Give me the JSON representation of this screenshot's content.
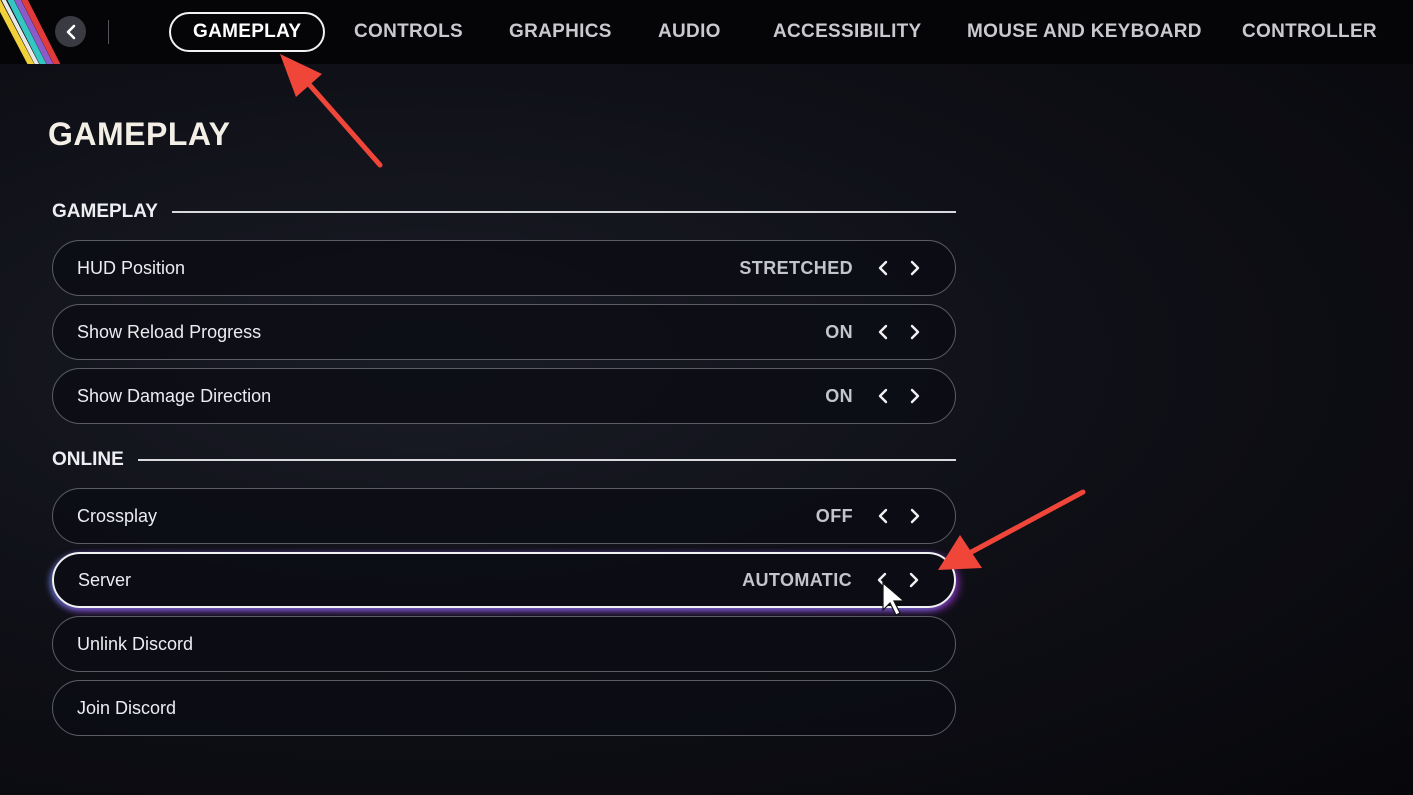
{
  "tabs": [
    {
      "label": "GAMEPLAY",
      "active": true
    },
    {
      "label": "CONTROLS"
    },
    {
      "label": "GRAPHICS"
    },
    {
      "label": "AUDIO"
    },
    {
      "label": "ACCESSIBILITY"
    },
    {
      "label": "MOUSE AND KEYBOARD"
    },
    {
      "label": "CONTROLLER"
    }
  ],
  "page_title": "GAMEPLAY",
  "sections": [
    {
      "label": "GAMEPLAY"
    },
    {
      "label": "ONLINE"
    }
  ],
  "settings": [
    {
      "label": "HUD Position",
      "value": "STRETCHED"
    },
    {
      "label": "Show Reload Progress",
      "value": "ON"
    },
    {
      "label": "Show Damage Direction",
      "value": "ON"
    },
    {
      "label": "Crossplay",
      "value": "OFF"
    },
    {
      "label": "Server",
      "value": "AUTOMATIC"
    },
    {
      "label": "Unlink Discord"
    },
    {
      "label": "Join Discord"
    }
  ],
  "icons": {
    "back": "chevron-left-icon",
    "prev": "chevron-left-icon",
    "next": "chevron-right-icon",
    "cursor": "mouse-pointer-icon",
    "annotation": "red-arrow-icon"
  },
  "colors": {
    "annotation_arrow": "#f0463a",
    "focus_glow": "#b83cff",
    "background": "#0f1017"
  }
}
